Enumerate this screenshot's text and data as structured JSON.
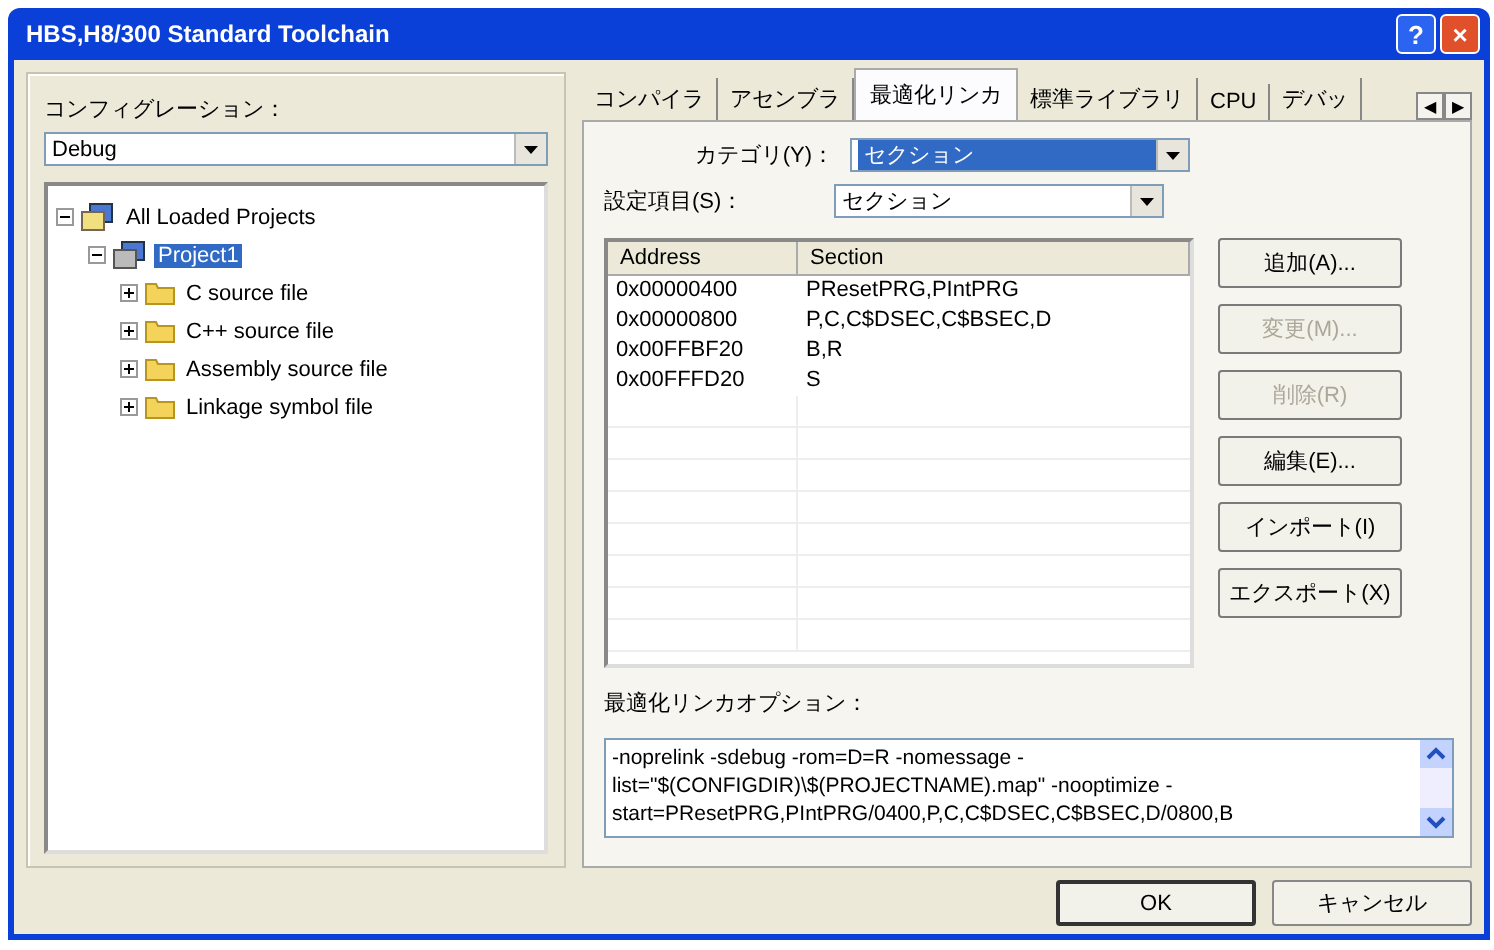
{
  "window": {
    "title": "HBS,H8/300 Standard Toolchain",
    "help_button": "?",
    "close_button": "×"
  },
  "configuration": {
    "label": "コンフィグレーション：",
    "value": "Debug"
  },
  "project_tree": [
    {
      "label": "All Loaded Projects",
      "kind": "workspace",
      "expanded": true,
      "selected": false,
      "children": [
        {
          "label": "Project1",
          "kind": "project",
          "expanded": true,
          "selected": true,
          "children": [
            {
              "label": "C source file",
              "kind": "folder",
              "expanded": false,
              "selected": false
            },
            {
              "label": "C++ source file",
              "kind": "folder",
              "expanded": false,
              "selected": false
            },
            {
              "label": "Assembly source file",
              "kind": "folder",
              "expanded": false,
              "selected": false
            },
            {
              "label": "Linkage symbol file",
              "kind": "folder",
              "expanded": false,
              "selected": false
            }
          ]
        }
      ]
    }
  ],
  "tabs": [
    {
      "label": "コンパイラ",
      "selected": false
    },
    {
      "label": "アセンブラ",
      "selected": false
    },
    {
      "label": "最適化リンカ",
      "selected": true
    },
    {
      "label": "標準ライブラリ",
      "selected": false
    },
    {
      "label": "CPU",
      "selected": false
    },
    {
      "label": "デバッ",
      "selected": false
    }
  ],
  "tab_scroll": [
    "◀",
    "▶"
  ],
  "category": {
    "label": "カテゴリ(Y)：",
    "value": "セクション",
    "focused": true
  },
  "setting_item": {
    "label": "設定項目(S)：",
    "value": "セクション",
    "focused": false
  },
  "table": {
    "columns": [
      "Address",
      "Section"
    ],
    "rows": [
      [
        "0x00000400",
        "PResetPRG,PIntPRG"
      ],
      [
        "0x00000800",
        "P,C,C$DSEC,C$BSEC,D"
      ],
      [
        "0x00FFBF20",
        "B,R"
      ],
      [
        "0x00FFFD20",
        "S"
      ]
    ]
  },
  "side_buttons": [
    {
      "label": "追加(A)...",
      "disabled": false
    },
    {
      "label": "変更(M)...",
      "disabled": true
    },
    {
      "label": "削除(R)",
      "disabled": true
    },
    {
      "label": "編集(E)...",
      "disabled": false
    },
    {
      "label": "インポート(I)",
      "disabled": false
    },
    {
      "label": "エクスポート(X)",
      "disabled": false
    }
  ],
  "options": {
    "label": "最適化リンカオプション：",
    "lines": [
      "-noprelink -sdebug -rom=D=R -nomessage -",
      "list=\"$(CONFIGDIR)\\$(PROJECTNAME).map\" -nooptimize -",
      "start=PResetPRG,PIntPRG/0400,P,C,C$DSEC,C$BSEC,D/0800,B"
    ]
  },
  "buttons": [
    {
      "label": "OK",
      "default": true
    },
    {
      "label": "キャンセル",
      "default": false
    }
  ]
}
